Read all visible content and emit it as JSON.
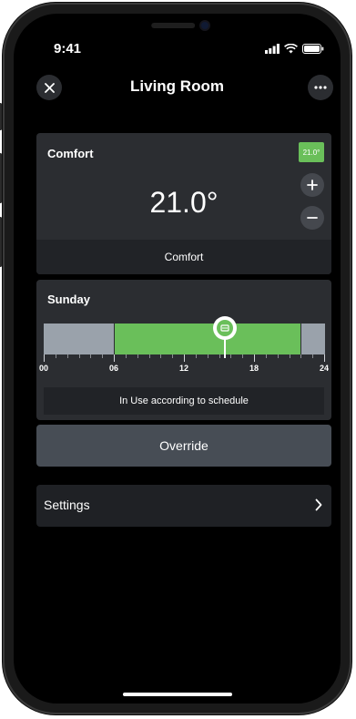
{
  "status_bar": {
    "time": "9:41"
  },
  "nav": {
    "title": "Living Room"
  },
  "comfort_card": {
    "label": "Comfort",
    "badge": "21.0°",
    "temperature": "21.0°",
    "mode": "Comfort"
  },
  "schedule_card": {
    "day": "Sunday",
    "axis_labels": [
      "00",
      "06",
      "12",
      "18",
      "24"
    ],
    "segments": [
      {
        "from_hour": 0,
        "to_hour": 6,
        "mode": "off"
      },
      {
        "from_hour": 6,
        "to_hour": 22,
        "mode": "comfort"
      },
      {
        "from_hour": 22,
        "to_hour": 24,
        "mode": "off"
      }
    ],
    "current_hour": 15.5,
    "status": "In Use according to schedule"
  },
  "override_button": {
    "label": "Override"
  },
  "settings_row": {
    "label": "Settings"
  },
  "colors": {
    "comfort_green": "#6abf5a",
    "off_grey": "#9aa2ab",
    "card_bg": "#2b2d31"
  }
}
